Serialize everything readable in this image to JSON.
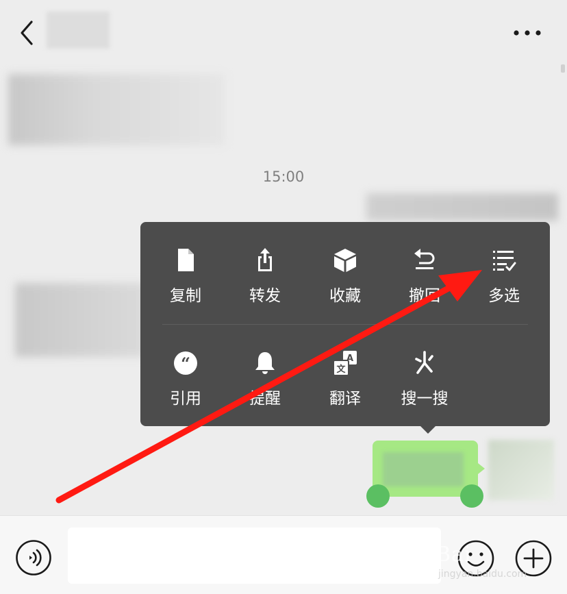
{
  "timestamp": "15:00",
  "menu": {
    "row1": [
      {
        "label": "复制",
        "icon": "document-icon"
      },
      {
        "label": "转发",
        "icon": "share-icon"
      },
      {
        "label": "收藏",
        "icon": "cube-icon"
      },
      {
        "label": "撤回",
        "icon": "undo-icon"
      },
      {
        "label": "多选",
        "icon": "multi-select-icon"
      }
    ],
    "row2": [
      {
        "label": "引用",
        "icon": "quote-icon"
      },
      {
        "label": "提醒",
        "icon": "bell-icon"
      },
      {
        "label": "翻译",
        "icon": "translate-icon"
      },
      {
        "label": "搜一搜",
        "icon": "search-spark-icon"
      }
    ]
  },
  "watermark": {
    "text": "Bai",
    "sub": "jingyan.baidu.com"
  },
  "colors": {
    "menu_bg": "#4c4c4c",
    "bubble": "#a6e884",
    "handle": "#5bbf62",
    "arrow": "#ff1a12",
    "background": "#ededed"
  }
}
